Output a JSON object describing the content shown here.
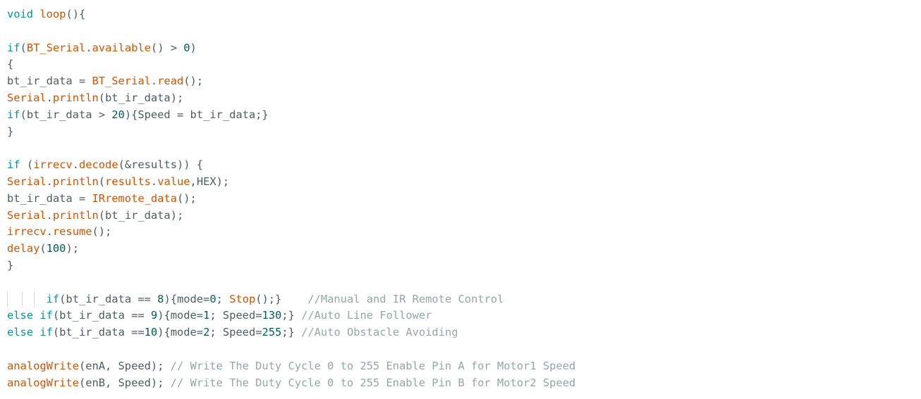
{
  "editor": {
    "lines": [
      [
        {
          "t": "void",
          "c": "kw"
        },
        {
          "t": " "
        },
        {
          "t": "loop",
          "c": "fn"
        },
        {
          "t": "(){"
        }
      ],
      [],
      [
        {
          "t": "if",
          "c": "kw"
        },
        {
          "t": "("
        },
        {
          "t": "BT_Serial",
          "c": "fn"
        },
        {
          "t": "."
        },
        {
          "t": "available",
          "c": "fn"
        },
        {
          "t": "() > "
        },
        {
          "t": "0",
          "c": "num"
        },
        {
          "t": ")"
        }
      ],
      [
        {
          "t": "{"
        }
      ],
      [
        {
          "t": "bt_ir_data = "
        },
        {
          "t": "BT_Serial",
          "c": "fn"
        },
        {
          "t": "."
        },
        {
          "t": "read",
          "c": "fn"
        },
        {
          "t": "();"
        }
      ],
      [
        {
          "t": "Serial",
          "c": "fn"
        },
        {
          "t": "."
        },
        {
          "t": "println",
          "c": "fn"
        },
        {
          "t": "(bt_ir_data);"
        }
      ],
      [
        {
          "t": "if",
          "c": "kw"
        },
        {
          "t": "(bt_ir_data > "
        },
        {
          "t": "20",
          "c": "num"
        },
        {
          "t": "){Speed = bt_ir_data;}"
        }
      ],
      [
        {
          "t": "}"
        }
      ],
      [],
      [
        {
          "t": "if",
          "c": "kw"
        },
        {
          "t": " ("
        },
        {
          "t": "irrecv",
          "c": "fn"
        },
        {
          "t": "."
        },
        {
          "t": "decode",
          "c": "fn"
        },
        {
          "t": "(&results)) {"
        }
      ],
      [
        {
          "t": "Serial",
          "c": "fn"
        },
        {
          "t": "."
        },
        {
          "t": "println",
          "c": "fn"
        },
        {
          "t": "("
        },
        {
          "t": "results",
          "c": "fn"
        },
        {
          "t": "."
        },
        {
          "t": "value",
          "c": "fn"
        },
        {
          "t": ",HEX);"
        }
      ],
      [
        {
          "t": "bt_ir_data = "
        },
        {
          "t": "IRremote_data",
          "c": "fn"
        },
        {
          "t": "();"
        }
      ],
      [
        {
          "t": "Serial",
          "c": "fn"
        },
        {
          "t": "."
        },
        {
          "t": "println",
          "c": "fn"
        },
        {
          "t": "(bt_ir_data);"
        }
      ],
      [
        {
          "t": "irrecv",
          "c": "fn"
        },
        {
          "t": "."
        },
        {
          "t": "resume",
          "c": "fn"
        },
        {
          "t": "();"
        }
      ],
      [
        {
          "t": "delay",
          "c": "fn"
        },
        {
          "t": "("
        },
        {
          "t": "100",
          "c": "num"
        },
        {
          "t": ");"
        }
      ],
      [
        {
          "t": "}"
        }
      ],
      [],
      [
        {
          "t": "      "
        },
        {
          "t": "if",
          "c": "kw"
        },
        {
          "t": "(bt_ir_data == "
        },
        {
          "t": "8",
          "c": "num"
        },
        {
          "t": "){mode="
        },
        {
          "t": "0",
          "c": "num"
        },
        {
          "t": "; "
        },
        {
          "t": "Stop",
          "c": "fn"
        },
        {
          "t": "();}    "
        },
        {
          "t": "//Manual and IR Remote Control",
          "c": "cmt"
        }
      ],
      [
        {
          "t": "else",
          "c": "kw"
        },
        {
          "t": " "
        },
        {
          "t": "if",
          "c": "kw"
        },
        {
          "t": "(bt_ir_data == "
        },
        {
          "t": "9",
          "c": "num"
        },
        {
          "t": "){mode="
        },
        {
          "t": "1",
          "c": "num"
        },
        {
          "t": "; Speed="
        },
        {
          "t": "130",
          "c": "num"
        },
        {
          "t": ";} "
        },
        {
          "t": "//Auto Line Follower",
          "c": "cmt"
        }
      ],
      [
        {
          "t": "else",
          "c": "kw"
        },
        {
          "t": " "
        },
        {
          "t": "if",
          "c": "kw"
        },
        {
          "t": "(bt_ir_data =="
        },
        {
          "t": "10",
          "c": "num"
        },
        {
          "t": "){mode="
        },
        {
          "t": "2",
          "c": "num"
        },
        {
          "t": "; Speed="
        },
        {
          "t": "255",
          "c": "num"
        },
        {
          "t": ";} "
        },
        {
          "t": "//Auto Obstacle Avoiding",
          "c": "cmt"
        }
      ],
      [],
      [
        {
          "t": "analogWrite",
          "c": "fn"
        },
        {
          "t": "(enA, Speed); "
        },
        {
          "t": "// Write The Duty Cycle 0 to 255 Enable Pin A for Motor1 Speed",
          "c": "cmt"
        }
      ],
      [
        {
          "t": "analogWrite",
          "c": "fn"
        },
        {
          "t": "(enB, Speed); "
        },
        {
          "t": "// Write The Duty Cycle 0 to 255 Enable Pin B for Motor2 Speed",
          "c": "cmt"
        }
      ]
    ],
    "colors": {
      "keyword": "#00979d",
      "function": "#d35400",
      "number": "#005c5f",
      "comment": "#95a5a6",
      "text": "#4e5b61",
      "background": "#ffffff"
    }
  }
}
